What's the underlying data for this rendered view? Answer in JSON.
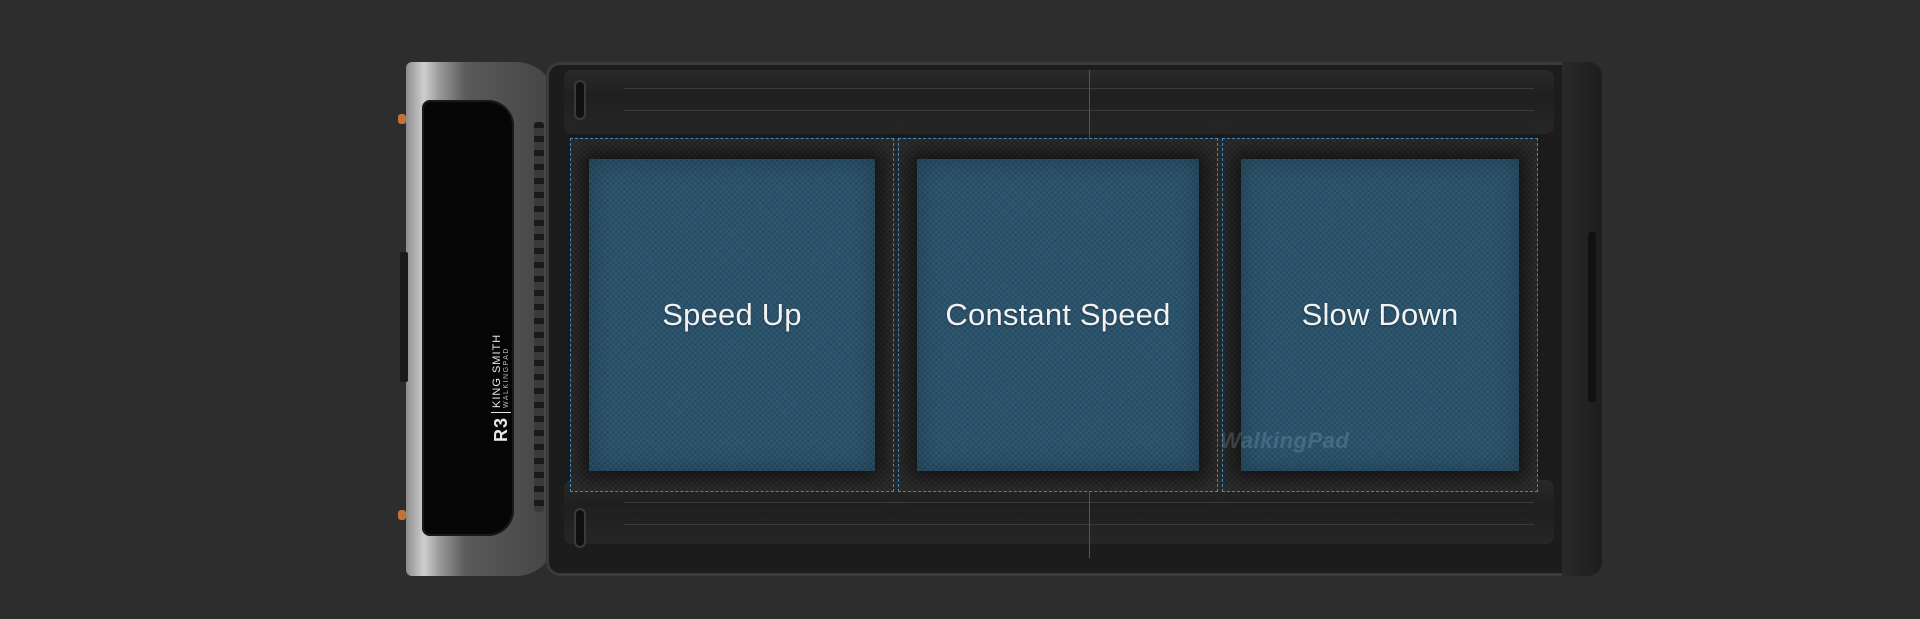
{
  "product": {
    "model": "R3",
    "brand": "KING SMITH",
    "sub_brand": "WALKINGPAD"
  },
  "zones": [
    {
      "label": "Speed Up"
    },
    {
      "label": "Constant Speed"
    },
    {
      "label": "Slow Down"
    }
  ],
  "watermark": "WalkingPad",
  "colors": {
    "background": "#2d2d2d",
    "zone_fill": "#2e5770",
    "zone_border": "#3d8fc7",
    "accent_dot": "#c4713a"
  }
}
